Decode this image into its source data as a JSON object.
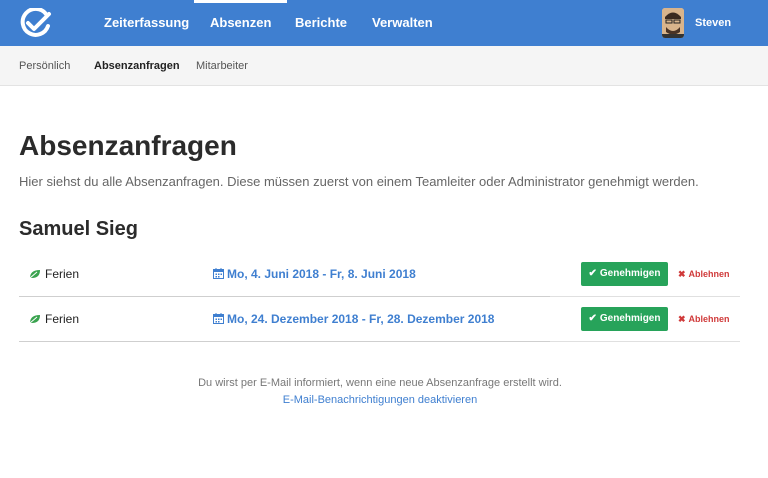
{
  "header": {
    "logo_icon": "checkmark-circle-logo",
    "nav": [
      {
        "label": "Zeiterfassung",
        "active": false
      },
      {
        "label": "Absenzen",
        "active": true
      },
      {
        "label": "Berichte",
        "active": false
      },
      {
        "label": "Verwalten",
        "active": false
      }
    ],
    "user": {
      "name": "Steven",
      "avatar_icon": "user-avatar"
    }
  },
  "subnav": [
    {
      "label": "Persönlich",
      "active": false
    },
    {
      "label": "Absenzanfragen",
      "active": true
    },
    {
      "label": "Mitarbeiter",
      "active": false
    }
  ],
  "page": {
    "title": "Absenzanfragen",
    "description": "Hier siehst du alle Absenzanfragen. Diese müssen zuerst von einem Teamleiter oder Administrator genehmigt werden."
  },
  "groups": [
    {
      "person": "Samuel Sieg",
      "requests": [
        {
          "type": "Ferien",
          "type_icon": "leaf-icon",
          "date_icon": "calendar-icon",
          "range": "Mo, 4. Juni 2018 - Fr, 8. Juni 2018",
          "approve_label": "Genehmigen",
          "reject_label": "Ablehnen"
        },
        {
          "type": "Ferien",
          "type_icon": "leaf-icon",
          "date_icon": "calendar-icon",
          "range": "Mo, 24. Dezember 2018 - Fr, 28. Dezember 2018",
          "approve_label": "Genehmigen",
          "reject_label": "Ablehnen"
        }
      ]
    }
  ],
  "footer": {
    "note": "Du wirst per E-Mail informiert, wenn eine neue Absenzanfrage erstellt wird.",
    "link": "E-Mail-Benachrichtigungen deaktivieren"
  },
  "colors": {
    "brand": "#3f7fd0",
    "approve": "#27a35a",
    "reject": "#d03a3a",
    "leaf": "#3aa34f"
  }
}
